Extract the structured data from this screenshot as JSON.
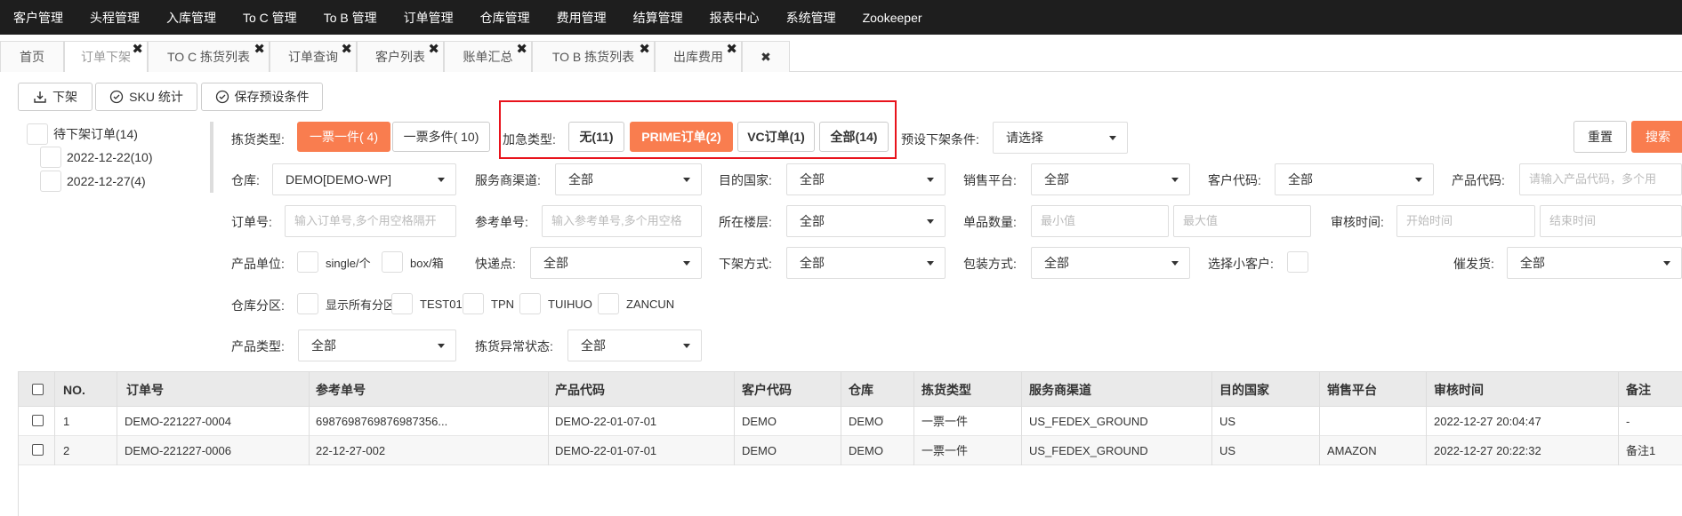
{
  "topnav": [
    "客户管理",
    "头程管理",
    "入库管理",
    "To C 管理",
    "To B 管理",
    "订单管理",
    "仓库管理",
    "费用管理",
    "结算管理",
    "报表中心",
    "系统管理",
    "Zookeeper"
  ],
  "tabs": [
    {
      "label": "首页",
      "closable": false
    },
    {
      "label": "订单下架",
      "closable": true,
      "active": true
    },
    {
      "label": "TO C 拣货列表",
      "closable": true
    },
    {
      "label": "订单查询",
      "closable": true
    },
    {
      "label": "客户列表",
      "closable": true
    },
    {
      "label": "账单汇总",
      "closable": true
    },
    {
      "label": "TO B 拣货列表",
      "closable": true
    },
    {
      "label": "出库费用",
      "closable": true
    }
  ],
  "tab_close_all": "✖",
  "toolbar": {
    "offshelf": "下架",
    "sku_stats": "SKU 统计",
    "save_preset": "保存预设条件"
  },
  "tree": {
    "root": "待下架订单(14)",
    "children": [
      "2022-12-22(10)",
      "2022-12-27(4)"
    ]
  },
  "filters": {
    "pick_type_label": "拣货类型:",
    "pick_single": "一票一件( 4)",
    "pick_multi": "一票多件( 10)",
    "urgent_label": "加急类型:",
    "urgent_none": "无(11)",
    "urgent_prime": "PRIME订单(2)",
    "urgent_vc": "VC订单(1)",
    "urgent_all": "全部(14)",
    "preset_label": "预设下架条件:",
    "preset_value": "请选择",
    "reset": "重置",
    "search": "搜索",
    "warehouse_label": "仓库:",
    "warehouse_value": "DEMO[DEMO-WP]",
    "channel_label": "服务商渠道:",
    "channel_value": "全部",
    "country_label": "目的国家:",
    "country_value": "全部",
    "platform_label": "销售平台:",
    "platform_value": "全部",
    "customer_code_label": "客户代码:",
    "customer_code_value": "全部",
    "product_code_label": "产品代码:",
    "product_code_placeholder": "请输入产品代码，多个用",
    "order_no_label": "订单号:",
    "order_no_placeholder": "输入订单号,多个用空格隔开",
    "ref_no_label": "参考单号:",
    "ref_no_placeholder": "输入参考单号,多个用空格",
    "floor_label": "所在楼层:",
    "floor_value": "全部",
    "qty_label": "单品数量:",
    "qty_min": "最小值",
    "qty_max": "最大值",
    "audit_label": "审核时间:",
    "audit_start": "开始时间",
    "audit_end": "结束时间",
    "unit_label": "产品单位:",
    "unit_single": "single/个",
    "unit_box": "box/箱",
    "express_label": "快递点:",
    "express_value": "全部",
    "offshelf_mode_label": "下架方式:",
    "offshelf_mode_value": "全部",
    "pack_label": "包装方式:",
    "pack_value": "全部",
    "small_customer_label": "选择小客户:",
    "urge_label": "催发货:",
    "urge_value": "全部",
    "zone_label": "仓库分区:",
    "zone_all": "显示所有分区",
    "zones": [
      "TEST01",
      "TPN",
      "TUIHUO",
      "ZANCUN"
    ],
    "product_type_label": "产品类型:",
    "product_type_value": "全部",
    "pick_exception_label": "拣货异常状态:",
    "pick_exception_value": "全部"
  },
  "table": {
    "columns": [
      "NO.",
      "订单号",
      "参考单号",
      "产品代码",
      "客户代码",
      "仓库",
      "拣货类型",
      "服务商渠道",
      "目的国家",
      "销售平台",
      "审核时间",
      "备注"
    ],
    "rows": [
      [
        "1",
        "DEMO-221227-0004",
        "6987698769876987356...",
        "DEMO-22-01-07-01",
        "DEMO",
        "DEMO",
        "一票一件",
        "US_FEDEX_GROUND",
        "US",
        "",
        "2022-12-27 20:04:47",
        "-"
      ],
      [
        "2",
        "DEMO-221227-0006",
        "22-12-27-002",
        "DEMO-22-01-07-01",
        "DEMO",
        "DEMO",
        "一票一件",
        "US_FEDEX_GROUND",
        "US",
        "AMAZON",
        "2022-12-27 20:22:32",
        "备注1"
      ]
    ]
  },
  "colors": {
    "accent": "#f97d4f",
    "topnav_bg": "#1e1e1e",
    "highlight_box": "#e8131c"
  }
}
